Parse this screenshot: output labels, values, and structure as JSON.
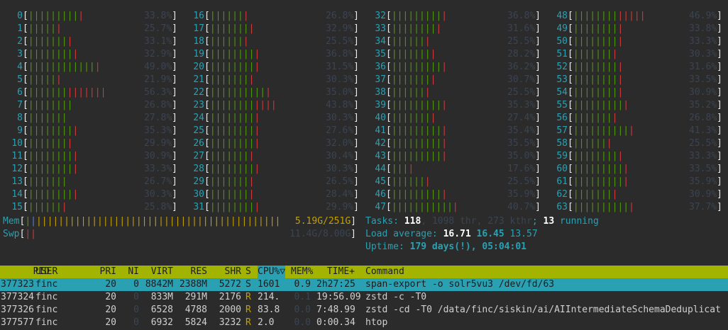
{
  "cpus": [
    {
      "id": "0",
      "g": 9,
      "r": 1,
      "pct": "33.8%"
    },
    {
      "id": "1",
      "g": 5,
      "r": 1,
      "pct": "25.7%"
    },
    {
      "id": "2",
      "g": 7,
      "r": 1,
      "pct": "33.1%"
    },
    {
      "id": "3",
      "g": 8,
      "r": 1,
      "pct": "32.9%"
    },
    {
      "id": "4",
      "g": 12,
      "r": 1,
      "pct": "49.0%"
    },
    {
      "id": "5",
      "g": 5,
      "r": 1,
      "pct": "21.9%"
    },
    {
      "id": "6",
      "g": 7,
      "r": 7,
      "pct": "56.3%"
    },
    {
      "id": "7",
      "g": 8,
      "r": 0,
      "pct": "26.8%"
    },
    {
      "id": "8",
      "g": 7,
      "r": 0,
      "pct": "27.8%"
    },
    {
      "id": "9",
      "g": 8,
      "r": 1,
      "pct": "35.3%"
    },
    {
      "id": "10",
      "g": 7,
      "r": 1,
      "pct": "29.9%"
    },
    {
      "id": "11",
      "g": 8,
      "r": 1,
      "pct": "30.9%"
    },
    {
      "id": "12",
      "g": 8,
      "r": 1,
      "pct": "33.3%"
    },
    {
      "id": "13",
      "g": 7,
      "r": 0,
      "pct": "26.7%"
    },
    {
      "id": "14",
      "g": 8,
      "r": 1,
      "pct": "30.3%"
    },
    {
      "id": "15",
      "g": 6,
      "r": 1,
      "pct": "25.8%"
    },
    {
      "id": "16",
      "g": 6,
      "r": 1,
      "pct": "26.8%"
    },
    {
      "id": "17",
      "g": 7,
      "r": 1,
      "pct": "32.9%"
    },
    {
      "id": "18",
      "g": 6,
      "r": 1,
      "pct": "25.5%"
    },
    {
      "id": "19",
      "g": 8,
      "r": 1,
      "pct": "36.8%"
    },
    {
      "id": "20",
      "g": 8,
      "r": 1,
      "pct": "31.5%"
    },
    {
      "id": "21",
      "g": 7,
      "r": 1,
      "pct": "30.3%"
    },
    {
      "id": "22",
      "g": 10,
      "r": 1,
      "pct": "35.0%"
    },
    {
      "id": "23",
      "g": 8,
      "r": 4,
      "pct": "43.8%"
    },
    {
      "id": "24",
      "g": 8,
      "r": 1,
      "pct": "30.3%"
    },
    {
      "id": "25",
      "g": 8,
      "r": 1,
      "pct": "27.6%"
    },
    {
      "id": "26",
      "g": 8,
      "r": 1,
      "pct": "32.0%"
    },
    {
      "id": "27",
      "g": 7,
      "r": 1,
      "pct": "30.4%"
    },
    {
      "id": "28",
      "g": 8,
      "r": 1,
      "pct": "30.3%"
    },
    {
      "id": "29",
      "g": 7,
      "r": 1,
      "pct": "26.5%"
    },
    {
      "id": "30",
      "g": 7,
      "r": 1,
      "pct": "28.4%"
    },
    {
      "id": "31",
      "g": 8,
      "r": 1,
      "pct": "29.9%"
    },
    {
      "id": "32",
      "g": 9,
      "r": 1,
      "pct": "36.8%"
    },
    {
      "id": "33",
      "g": 8,
      "r": 1,
      "pct": "31.6%"
    },
    {
      "id": "34",
      "g": 6,
      "r": 1,
      "pct": "25.5%"
    },
    {
      "id": "35",
      "g": 7,
      "r": 1,
      "pct": "28.2%"
    },
    {
      "id": "36",
      "g": 9,
      "r": 1,
      "pct": "36.2%"
    },
    {
      "id": "37",
      "g": 7,
      "r": 1,
      "pct": "30.7%"
    },
    {
      "id": "38",
      "g": 6,
      "r": 1,
      "pct": "25.5%"
    },
    {
      "id": "39",
      "g": 9,
      "r": 1,
      "pct": "35.3%"
    },
    {
      "id": "40",
      "g": 7,
      "r": 1,
      "pct": "27.4%"
    },
    {
      "id": "41",
      "g": 9,
      "r": 1,
      "pct": "35.4%"
    },
    {
      "id": "42",
      "g": 9,
      "r": 1,
      "pct": "35.5%"
    },
    {
      "id": "43",
      "g": 9,
      "r": 1,
      "pct": "35.0%"
    },
    {
      "id": "44",
      "g": 3,
      "r": 1,
      "pct": "17.6%"
    },
    {
      "id": "45",
      "g": 6,
      "r": 1,
      "pct": "25.5%"
    },
    {
      "id": "46",
      "g": 9,
      "r": 1,
      "pct": "35.9%"
    },
    {
      "id": "47",
      "g": 11,
      "r": 1,
      "pct": "40.7%"
    },
    {
      "id": "48",
      "g": 8,
      "r": 5,
      "pct": "46.9%"
    },
    {
      "id": "49",
      "g": 8,
      "r": 1,
      "pct": "33.8%"
    },
    {
      "id": "50",
      "g": 8,
      "r": 1,
      "pct": "33.3%"
    },
    {
      "id": "51",
      "g": 7,
      "r": 1,
      "pct": "30.3%"
    },
    {
      "id": "52",
      "g": 8,
      "r": 1,
      "pct": "31.6%"
    },
    {
      "id": "53",
      "g": 8,
      "r": 1,
      "pct": "33.5%"
    },
    {
      "id": "54",
      "g": 8,
      "r": 1,
      "pct": "30.9%"
    },
    {
      "id": "55",
      "g": 9,
      "r": 1,
      "pct": "35.2%"
    },
    {
      "id": "56",
      "g": 7,
      "r": 1,
      "pct": "26.8%"
    },
    {
      "id": "57",
      "g": 10,
      "r": 1,
      "pct": "41.3%"
    },
    {
      "id": "58",
      "g": 6,
      "r": 1,
      "pct": "25.5%"
    },
    {
      "id": "59",
      "g": 8,
      "r": 1,
      "pct": "33.3%"
    },
    {
      "id": "60",
      "g": 9,
      "r": 1,
      "pct": "33.5%"
    },
    {
      "id": "61",
      "g": 9,
      "r": 1,
      "pct": "35.9%"
    },
    {
      "id": "62",
      "g": 7,
      "r": 1,
      "pct": "30.9%"
    },
    {
      "id": "63",
      "g": 10,
      "r": 1,
      "pct": "37.7%"
    }
  ],
  "mem": {
    "label": "Mem",
    "value": "5.19G/251G"
  },
  "swp": {
    "label": "Swp",
    "value": "11.4G/8.00G"
  },
  "tasks": {
    "label": "Tasks:",
    "count": "118",
    "thr": "1098 thr",
    "kthr": "273 kthr",
    "sep": ";",
    "running": "13",
    "running_label": "running"
  },
  "load": {
    "label": "Load average:",
    "l1": "16.71",
    "l5": "16.45",
    "l15": "13.57"
  },
  "uptime": {
    "label": "Uptime:",
    "value": "179 days(!), 05:04:01"
  },
  "columns": [
    "PID",
    "USER",
    "PRI",
    "NI",
    "VIRT",
    "RES",
    "SHR",
    "S",
    "CPU%▽",
    "MEM%",
    "TIME+",
    "Command"
  ],
  "processes": [
    {
      "pid": "377323",
      "user": "finc",
      "pri": "20",
      "ni": "0",
      "virt": "8842M",
      "res": "2388M",
      "shr": "5272",
      "s": "S",
      "cpu": "1601",
      "mem": "0.9",
      "time": "2h27:25",
      "cmd": "span-export -o solr5vu3 /dev/fd/63",
      "selected": true
    },
    {
      "pid": "377324",
      "user": "finc",
      "pri": "20",
      "ni": "0",
      "virt": "833M",
      "res": "291M",
      "shr": "2176",
      "s": "R",
      "cpu": "214.",
      "mem": "0.1",
      "time": "19:56.09",
      "cmd": "zstd -c -T0",
      "selected": false
    },
    {
      "pid": "377326",
      "user": "finc",
      "pri": "20",
      "ni": "0",
      "virt": "6528",
      "res": "4788",
      "shr": "2000",
      "s": "R",
      "cpu": "83.8",
      "mem": "0.0",
      "time": "7:48.99",
      "cmd": "zstd -cd -T0 /data/finc/siskin/ai/AIIntermediateSchemaDeduplicat",
      "selected": false
    },
    {
      "pid": "377577",
      "user": "finc",
      "pri": "20",
      "ni": "0",
      "virt": "6932",
      "res": "5824",
      "shr": "3232",
      "s": "R",
      "cpu": "2.0",
      "mem": "0.0",
      "time": "0:00.34",
      "cmd": "htop",
      "selected": false
    }
  ]
}
